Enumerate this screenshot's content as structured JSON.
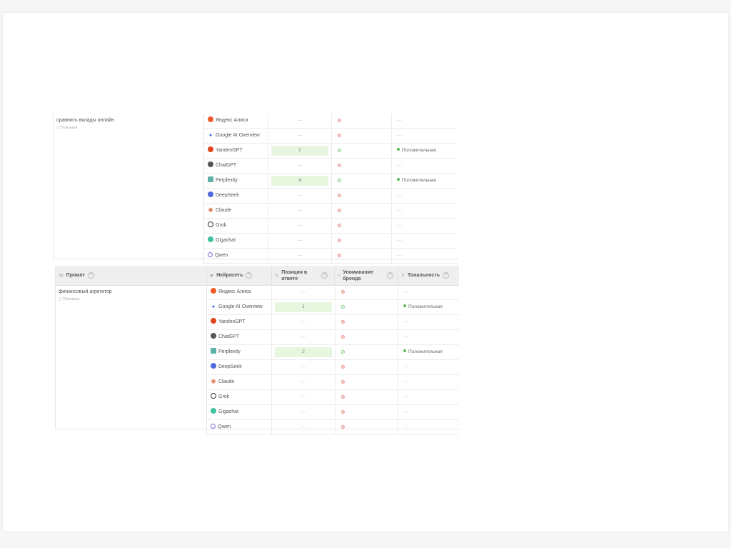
{
  "table1": {
    "prompt": "сравнить вклады онлайн",
    "prompt_tag": "Полезные",
    "rows": [
      {
        "model": "Яндекс Алиса",
        "icon": "alice-icon",
        "position": "—",
        "highlight": false,
        "mention": "no",
        "tone": "—"
      },
      {
        "model": "Google AI Overview",
        "icon": "google-ai-icon",
        "position": "—",
        "highlight": false,
        "mention": "no",
        "tone": "—"
      },
      {
        "model": "YandexGPT",
        "icon": "yandexgpt-icon",
        "position": "2",
        "highlight": true,
        "mention": "yes",
        "tone": "Положительная"
      },
      {
        "model": "ChatGPT",
        "icon": "chatgpt-icon",
        "position": "—",
        "highlight": false,
        "mention": "no",
        "tone": "—"
      },
      {
        "model": "Perplexity",
        "icon": "perplexity-icon",
        "position": "4",
        "highlight": true,
        "mention": "yes",
        "tone": "Положительная"
      },
      {
        "model": "DeepSeek",
        "icon": "deepseek-icon",
        "position": "—",
        "highlight": false,
        "mention": "no",
        "tone": "—"
      },
      {
        "model": "Claude",
        "icon": "claude-icon",
        "position": "—",
        "highlight": false,
        "mention": "no",
        "tone": "—"
      },
      {
        "model": "Grok",
        "icon": "grok-icon",
        "position": "—",
        "highlight": false,
        "mention": "no",
        "tone": "—"
      },
      {
        "model": "Gigachat",
        "icon": "gigachat-icon",
        "position": "—",
        "highlight": false,
        "mention": "no",
        "tone": "—"
      },
      {
        "model": "Qwen",
        "icon": "qwen-icon",
        "position": "—",
        "highlight": false,
        "mention": "no",
        "tone": "—"
      }
    ]
  },
  "table2": {
    "headers": {
      "prompt": "Промпт",
      "model": "Нейросеть",
      "position": "Позиция в ответе",
      "mention": "Упоминание бренда",
      "tone": "Тональность"
    },
    "prompt": "финансовый агрегатор",
    "prompt_tag": "Полезные",
    "rows": [
      {
        "model": "Яндекс Алиса",
        "icon": "alice-icon",
        "position": "—",
        "highlight": false,
        "mention": "no",
        "tone": "—"
      },
      {
        "model": "Google AI Overview",
        "icon": "google-ai-icon",
        "position": "1",
        "highlight": true,
        "mention": "yes",
        "tone": "Положительная"
      },
      {
        "model": "YandexGPT",
        "icon": "yandexgpt-icon",
        "position": "—",
        "highlight": false,
        "mention": "no",
        "tone": "—"
      },
      {
        "model": "ChatGPT",
        "icon": "chatgpt-icon",
        "position": "—",
        "highlight": false,
        "mention": "no",
        "tone": "—"
      },
      {
        "model": "Perplexity",
        "icon": "perplexity-icon",
        "position": "2",
        "highlight": true,
        "mention": "yes",
        "tone": "Положительная"
      },
      {
        "model": "DeepSeek",
        "icon": "deepseek-icon",
        "position": "—",
        "highlight": false,
        "mention": "no",
        "tone": "—"
      },
      {
        "model": "Claude",
        "icon": "claude-icon",
        "position": "—",
        "highlight": false,
        "mention": "no",
        "tone": "—"
      },
      {
        "model": "Grok",
        "icon": "grok-icon",
        "position": "—",
        "highlight": false,
        "mention": "no",
        "tone": "—"
      },
      {
        "model": "Gigachat",
        "icon": "gigachat-icon",
        "position": "—",
        "highlight": false,
        "mention": "no",
        "tone": "—"
      },
      {
        "model": "Qwen",
        "icon": "qwen-icon",
        "position": "—",
        "highlight": false,
        "mention": "no",
        "tone": "—"
      }
    ]
  },
  "colors": {
    "highlight_bg": "#e6f6df",
    "positive": "#5cba5c",
    "not_mentioned": "#e78a8a"
  }
}
